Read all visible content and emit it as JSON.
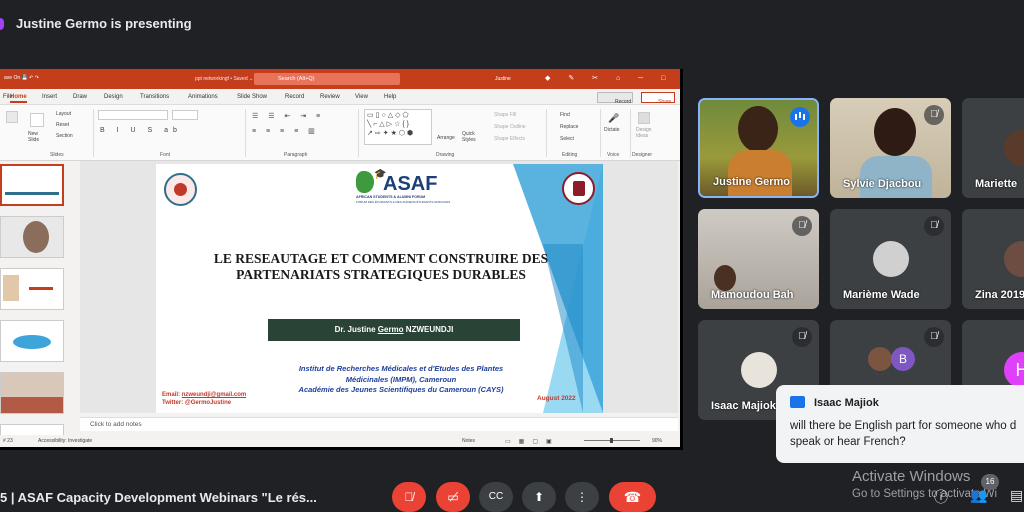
{
  "header": {
    "presenting_text": "Justine Germo is presenting"
  },
  "ppt": {
    "quick_access": "ave  On  💾  ↶  ↷",
    "filename": "ppt networkingf • Saved ⌄",
    "search_placeholder": "Search (Alt+Q)",
    "user": "Justine",
    "tabs": [
      "File",
      "Home",
      "Insert",
      "Draw",
      "Design",
      "Transitions",
      "Animations",
      "Slide Show",
      "Record",
      "Review",
      "View",
      "Help"
    ],
    "active_tab": "Home",
    "record_label": "Record",
    "share_label": "Share",
    "ribbon_groups": [
      "Slides",
      "Font",
      "Paragraph",
      "Drawing",
      "Editing",
      "Voice",
      "Designer"
    ],
    "ribbon_items": {
      "new_slide": "New Slide",
      "layout": "Layout",
      "reset": "Reset",
      "section": "Section",
      "arrange": "Arrange",
      "quick_styles": "Quick Styles",
      "shape_fill": "Shape Fill",
      "shape_outline": "Shape Outline",
      "shape_effects": "Shape Effects",
      "find": "Find",
      "replace": "Replace",
      "select": "Select",
      "dictate": "Dictate",
      "design_ideas": "Design Ideas"
    },
    "slide": {
      "asaf_wordmark": "ASAF",
      "asaf_tagline": "AFRICAN STUDENTS & ALUMNI FORUM",
      "asaf_tagline2": "FORUM DES ÉTUDIANTS & DES ANCIENS ÉTUDIANTS AFRICAINS",
      "title_line1": "LE RESEAUTAGE ET COMMENT CONSTRUIRE DES",
      "title_line2": "PARTENARIATS STRATEGIQUES DURABLES",
      "presenter_prefix": "Dr. Justine ",
      "presenter_underlined": "Germo",
      "presenter_suffix": " NZWEUNDJI",
      "institution_line1": "Institut de Recherches Médicales et d'Etudes des Plantes",
      "institution_line2": "Médicinales (IMPM), Cameroun",
      "institution_line3": "Académie des Jeunes Scientifiques du Cameroun (CAYS)",
      "email_label": "Email: ",
      "email": "nzweundji@gmail.com",
      "twitter": "Twitter: @GermoJustine",
      "date": "August 2022"
    },
    "notes_placeholder": "Click to add notes",
    "status": {
      "slide": "# 23",
      "accessibility": "Accessibility: Investigate",
      "notes": "Notes",
      "zoom": "90%"
    }
  },
  "participants": [
    {
      "name": "Justine Germo",
      "state": "speaking"
    },
    {
      "name": "Sylvie Djacbou",
      "state": "muted"
    },
    {
      "name": "Mariette",
      "state": "none"
    },
    {
      "name": "Mamoudou Bah",
      "state": "muted"
    },
    {
      "name": "Marième Wade",
      "state": "muted"
    },
    {
      "name": "Zina 2019",
      "state": "none"
    },
    {
      "name": "Isaac Majiok",
      "state": "muted"
    },
    {
      "name": "",
      "avatar_letter": "B",
      "state": "muted"
    },
    {
      "name": "",
      "avatar_letter": "H",
      "state": "none"
    }
  ],
  "chat": {
    "sender": "Isaac Majiok",
    "message": "will there be English part for someone who doesn't speak or hear French?",
    "visible_message": "will there be English part for someone who d speak or hear French?"
  },
  "watermark": {
    "line1": "Activate Windows",
    "line2": "Go to Settings to activate Wi"
  },
  "bottom": {
    "meeting_prefix": "5 |",
    "meeting_title": "ASAF Capacity Development Webinars \"Le rés...",
    "participant_count": "16"
  },
  "colors": {
    "ppt_accent": "#c43e1c",
    "end_call": "#ea4335",
    "speaking": "#1a73e8",
    "slide_bar": "#294437"
  }
}
